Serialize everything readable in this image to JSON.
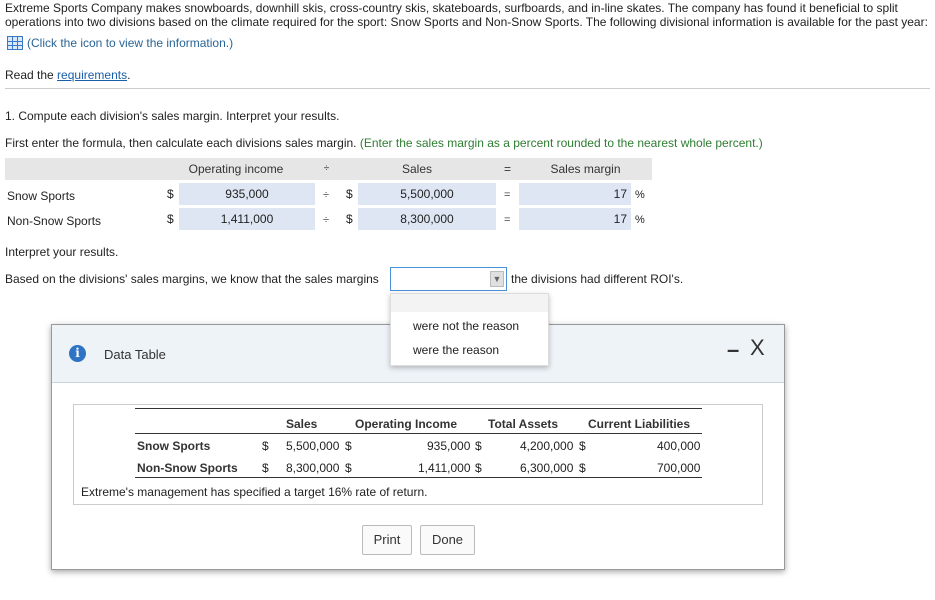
{
  "intro": {
    "line1": "Extreme Sports Company makes snowboards, downhill skis, cross-country skis, skateboards, surfboards, and in-line skates. The company has found it beneficial to split",
    "line2": "operations into two divisions based on the climate required for the sport: Snow Sports and Non-Snow Sports. The following divisional information is available for the past year:",
    "info_link": "(Click the icon to view the information.)"
  },
  "requirements": {
    "prefix": "Read the ",
    "link": "requirements",
    "suffix": "."
  },
  "question1": {
    "title": "1. Compute each division's sales margin. Interpret your results.",
    "instruction": "First enter the formula, then calculate each divisions sales margin.",
    "instruction_hint": "(Enter the sales margin as a percent rounded to the nearest whole percent.)"
  },
  "formula": {
    "h_operating_income": "Operating income",
    "h_divide": "÷",
    "h_sales": "Sales",
    "h_equals": "=",
    "h_sales_margin": "Sales margin",
    "rows": [
      {
        "label": "Snow Sports",
        "cur1": "$",
        "operating_income": "935,000",
        "op": "÷",
        "cur2": "$",
        "sales": "5,500,000",
        "eq": "=",
        "margin": "17",
        "pct": "%"
      },
      {
        "label": "Non-Snow Sports",
        "cur1": "$",
        "operating_income": "1,411,000",
        "op": "÷",
        "cur2": "$",
        "sales": "8,300,000",
        "eq": "=",
        "margin": "17",
        "pct": "%"
      }
    ]
  },
  "interpret": {
    "heading": "Interpret your results.",
    "prefix": "Based on the divisions' sales margins, we know that the sales margins",
    "select_value": "",
    "suffix": "the divisions had different ROI's.",
    "options": [
      "were not the reason",
      "were the reason"
    ]
  },
  "dialog": {
    "title": "Data Table",
    "minimize": "–",
    "close": "X",
    "headers": [
      "Sales",
      "Operating Income",
      "Total Assets",
      "Current Liabilities"
    ],
    "rows": [
      {
        "label": "Snow Sports",
        "c1": "$",
        "sales": "5,500,000",
        "c2": "$",
        "operating_income": "935,000",
        "c3": "$",
        "total_assets": "4,200,000",
        "c4": "$",
        "current_liabilities": "400,000"
      },
      {
        "label": "Non-Snow Sports",
        "c1": "$",
        "sales": "8,300,000",
        "c2": "$",
        "operating_income": "1,411,000",
        "c3": "$",
        "total_assets": "6,300,000",
        "c4": "$",
        "current_liabilities": "700,000"
      }
    ],
    "note": "Extreme's management has specified a target 16% rate of return.",
    "print_label": "Print",
    "done_label": "Done"
  },
  "colors": {
    "input_bg": "#dde6f2",
    "hint_green": "#2e7d32",
    "link_blue": "#1a5ea8",
    "info_icon_blue": "#2f73c4"
  }
}
